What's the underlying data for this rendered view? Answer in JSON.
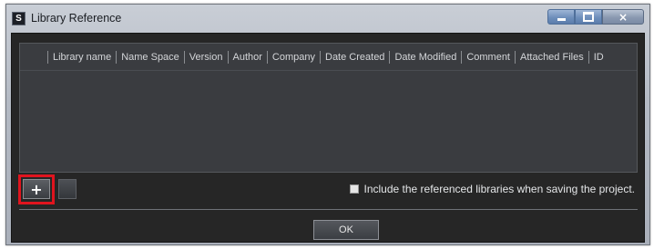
{
  "window": {
    "title": "Library Reference",
    "app_icon_glyph": "S",
    "controls": {
      "minimize": "minimize-icon",
      "maximize": "maximize-icon",
      "close": "×"
    }
  },
  "grid": {
    "columns": [
      "Library name",
      "Name Space",
      "Version",
      "Author",
      "Company",
      "Date Created",
      "Date Modified",
      "Comment",
      "Attached Files",
      "ID"
    ],
    "rows": []
  },
  "toolbar": {
    "add_glyph": "+",
    "add_icon": "plus-icon",
    "remove_icon": "minus-icon",
    "highlight_color": "#e0141e"
  },
  "options": {
    "include_referenced_label": "Include the referenced libraries when saving the project.",
    "include_referenced_checked": false
  },
  "footer": {
    "ok_label": "OK"
  }
}
